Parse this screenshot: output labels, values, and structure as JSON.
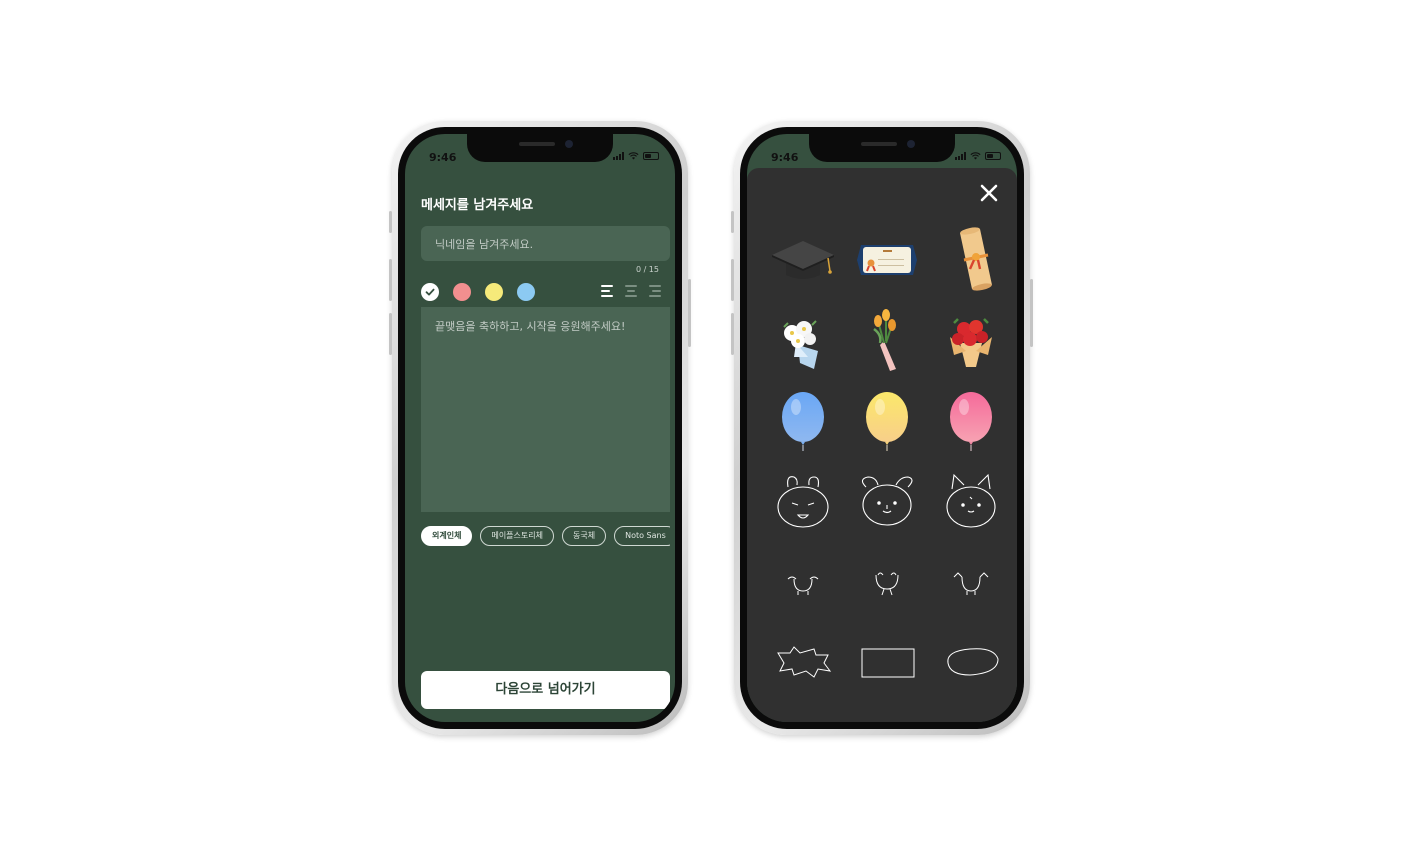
{
  "status_bar": {
    "time": "9:46"
  },
  "form": {
    "title": "메세지를 남겨주세요",
    "nickname_placeholder": "닉네임을 남겨주세요.",
    "nickname_counter": "0 / 15",
    "message_placeholder": "끝맺음을 축하하고, 시작을 응원해주세요!",
    "colors": [
      {
        "name": "white",
        "hex": "#ffffff",
        "selected": true
      },
      {
        "name": "pink",
        "hex": "#f28f8f",
        "selected": false
      },
      {
        "name": "yellow",
        "hex": "#f6ea7a",
        "selected": false
      },
      {
        "name": "blue",
        "hex": "#8ccaf2",
        "selected": false
      }
    ],
    "alignments": [
      {
        "name": "align-left",
        "selected": true
      },
      {
        "name": "align-center",
        "selected": false
      },
      {
        "name": "align-right",
        "selected": false
      }
    ],
    "fonts": [
      "외계인체",
      "메이플스토리체",
      "동국체",
      "Noto Sans"
    ],
    "selected_font": "외계인체",
    "next_label": "다음으로 넘어가기"
  },
  "stickers": {
    "close_icon": "close-icon",
    "items": [
      "graduation-cap",
      "certificate",
      "diploma-scroll",
      "white-flower-bouquet",
      "tulip-bouquet",
      "red-rose-bouquet",
      "blue-balloon",
      "yellow-balloon",
      "pink-balloon",
      "bear-face",
      "dog-face",
      "cat-face",
      "bear-hands",
      "cute-eyes",
      "cat-paws",
      "burst-frame",
      "rectangle-frame",
      "oval-frame"
    ]
  },
  "colors": {
    "green_bg": "#36503f",
    "input_bg": "#4a6554",
    "sheet_bg": "#303030"
  }
}
